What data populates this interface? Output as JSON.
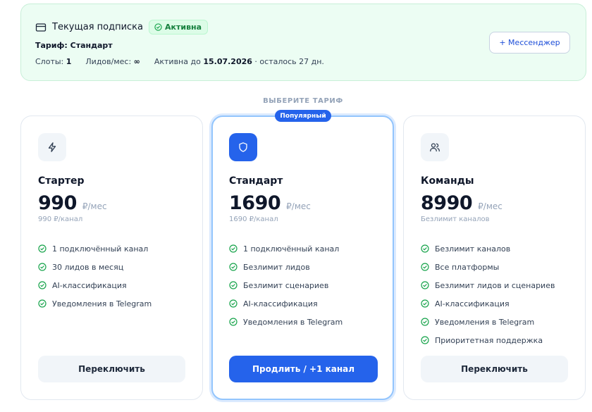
{
  "subscription": {
    "title": "Текущая подписка",
    "status": "Активна",
    "plan_line": "Тариф: Стандарт",
    "slots_label": "Слоты:",
    "slots_value": "1",
    "leads_label": "Лидов/мес:",
    "leads_value": "∞",
    "active_until_label": "Активна до",
    "active_until_date": "15.07.2026",
    "remaining": "· осталось 27 дн.",
    "messenger_button": "+ Мессенджер"
  },
  "section_label": "ВЫБЕРИТЕ ТАРИФ",
  "popular_badge": "Популярный",
  "plans": [
    {
      "icon": "lightning-icon",
      "name": "Стартер",
      "price": "990",
      "unit": "₽/мес",
      "per_channel": "990 ₽/канал",
      "features": [
        "1 подключённый канал",
        "30 лидов в месяц",
        "AI-классификация",
        "Уведомления в Telegram"
      ],
      "button": "Переключить"
    },
    {
      "icon": "shield-icon",
      "name": "Стандарт",
      "price": "1690",
      "unit": "₽/мес",
      "per_channel": "1690 ₽/канал",
      "features": [
        "1 подключённый канал",
        "Безлимит лидов",
        "Безлимит сценариев",
        "AI-классификация",
        "Уведомления в Telegram"
      ],
      "button": "Продлить / +1 канал"
    },
    {
      "icon": "users-icon",
      "name": "Команды",
      "price": "8990",
      "unit": "₽/мес",
      "per_channel": "Безлимит каналов",
      "features": [
        "Безлимит каналов",
        "Все платформы",
        "Безлимит лидов и сценариев",
        "AI-классификация",
        "Уведомления в Telegram",
        "Приоритетная поддержка"
      ],
      "button": "Переключить"
    }
  ],
  "colors": {
    "accent": "#2563eb",
    "success": "#16a34a",
    "subscription_bg": "#ecfdf3"
  }
}
